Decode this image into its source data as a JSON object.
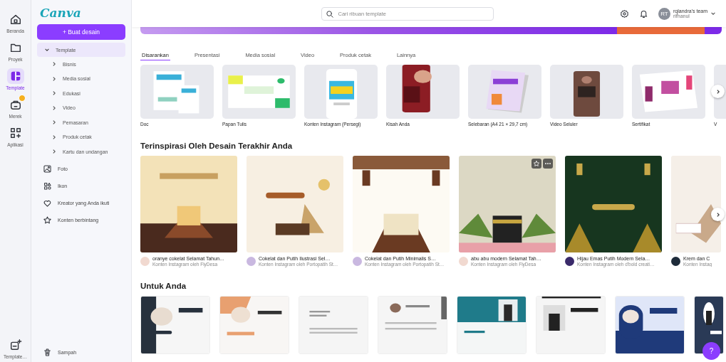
{
  "rail": [
    {
      "label": "Beranda",
      "selected": false,
      "badge": false
    },
    {
      "label": "Proyek",
      "selected": false,
      "badge": false
    },
    {
      "label": "Template",
      "selected": true,
      "badge": false
    },
    {
      "label": "Merek",
      "selected": false,
      "badge": true
    },
    {
      "label": "Aplikasi",
      "selected": false,
      "badge": false
    }
  ],
  "rail_bottom": {
    "label": "Template…"
  },
  "sidebar": {
    "logo": "Canva",
    "create_button": "+ Buat desain",
    "items": [
      {
        "label": "Template",
        "expanded": true,
        "selected": true,
        "children": [
          {
            "label": "Bisnis"
          },
          {
            "label": "Media sosial"
          },
          {
            "label": "Edukasi"
          },
          {
            "label": "Video"
          },
          {
            "label": "Pemasaran"
          },
          {
            "label": "Produk cetak"
          },
          {
            "label": "Kartu dan undangan"
          }
        ]
      },
      {
        "label": "Foto",
        "selected": false
      },
      {
        "label": "Ikon",
        "selected": false
      },
      {
        "label": "Kreator yang Anda ikuti",
        "selected": false
      },
      {
        "label": "Konten berbintang",
        "selected": false
      }
    ],
    "trash": "Sampah"
  },
  "topbar": {
    "search": {
      "placeholder": "Cari ribuan template"
    },
    "avatar": "RT",
    "team": "rqlandra's team",
    "user": "rifhanul"
  },
  "tabs": [
    {
      "label": "Disarankan",
      "selected": true
    },
    {
      "label": "Presentasi",
      "selected": false
    },
    {
      "label": "Media sosial",
      "selected": false
    },
    {
      "label": "Video",
      "selected": false
    },
    {
      "label": "Produk cetak",
      "selected": false
    },
    {
      "label": "Lainnya",
      "selected": false
    }
  ],
  "categories": [
    {
      "label": "Doc"
    },
    {
      "label": "Papan Tulis"
    },
    {
      "label": "Konten Instagram (Persegi)"
    },
    {
      "label": "Kisah Anda"
    },
    {
      "label": "Selebaran (A4 21 × 29,7 cm)"
    },
    {
      "label": "Video Seluler"
    },
    {
      "label": "Sertifikat"
    },
    {
      "label": "V"
    }
  ],
  "inspired": {
    "title": "Terinspirasi Oleh Desain Terakhir Anda",
    "items": [
      {
        "title": "oranye cokelat Selamat Tahun…",
        "byline": "Konten Instagram oleh FlyDesa",
        "hover": false
      },
      {
        "title": "Cokelat dan Putih Ilustrasi Sel…",
        "byline": "Konten Instagram oleh Portopatih St…",
        "hover": false
      },
      {
        "title": "Cokelat dan Putih Minimalis S…",
        "byline": "Konten Instagram oleh Portopatih St…",
        "hover": false
      },
      {
        "title": "abu abu modern Selamat Tah…",
        "byline": "Konten Instagram oleh FlyDesa",
        "hover": true
      },
      {
        "title": "Hijau Emas Putih Modern Sela…",
        "byline": "Konten Instagram oleh d'bold creati…",
        "hover": false
      },
      {
        "title": "Krem dan C",
        "byline": "Konten Instag",
        "hover": false
      }
    ]
  },
  "for_you": {
    "title": "Untuk Anda"
  },
  "help_button": "?"
}
